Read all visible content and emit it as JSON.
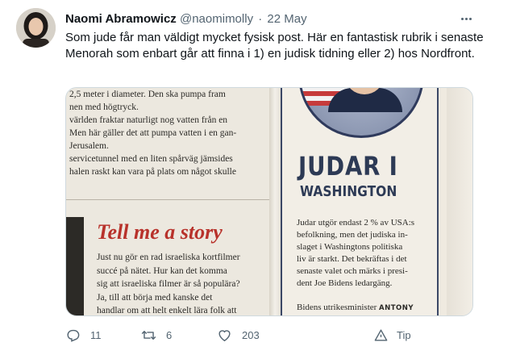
{
  "tweet": {
    "display_name": "Naomi Abramowicz",
    "handle": "@naomimolly",
    "separator": "·",
    "date": "22 May",
    "text": "Som jude får man väldigt mycket fysisk post. Här en fantastisk rubrik i senaste Menorah som enbart går att finna i 1) en judisk tidning eller 2) hos Nordfront."
  },
  "media": {
    "left_page_lines": [
      "2,5 meter i diameter. Den ska pumpa fram",
      "nen med högtryck.",
      "världen fraktar naturligt nog vatten från en",
      "Men här gäller det att pumpa vatten i en gan-",
      "Jerusalem.",
      "servicetunnel med en liten spårväg jämsides",
      "halen raskt kan vara på plats om något skulle"
    ],
    "story_title": "Tell me a story",
    "story_lines": [
      "Just nu gör en rad israeliska kortfilmer",
      "succé på nätet. Hur kan det komma",
      "sig att israeliska filmer är så populära?",
      "Ja, till att börja med kanske det",
      "handlar om att helt enkelt lära folk att"
    ],
    "box_title": "JUDAR I",
    "box_subtitle": "WASHINGTON",
    "box_lines": [
      "Judar utgör endast 2 % av USA:s",
      "befolkning, men det judiska in-",
      "slaget i Washingtons politiska",
      "liv är starkt. Det bekräftas i det",
      "senaste valet och märks i presi-",
      "dent Joe Bidens ledargäng."
    ],
    "box_last_prefix": "Bidens utrikesminister",
    "box_last_name": "ANTONY"
  },
  "actions": {
    "reply_count": "11",
    "retweet_count": "6",
    "like_count": "203",
    "share_label": "Tip"
  },
  "icons": {
    "reply": "reply-icon",
    "retweet": "retweet-icon",
    "like": "heart-icon",
    "share": "tip-icon",
    "more": "more-icon"
  },
  "colors": {
    "text": "#0f1419",
    "secondary": "#536471",
    "headline_red": "#b8322b",
    "box_navy": "#2d3a55"
  }
}
